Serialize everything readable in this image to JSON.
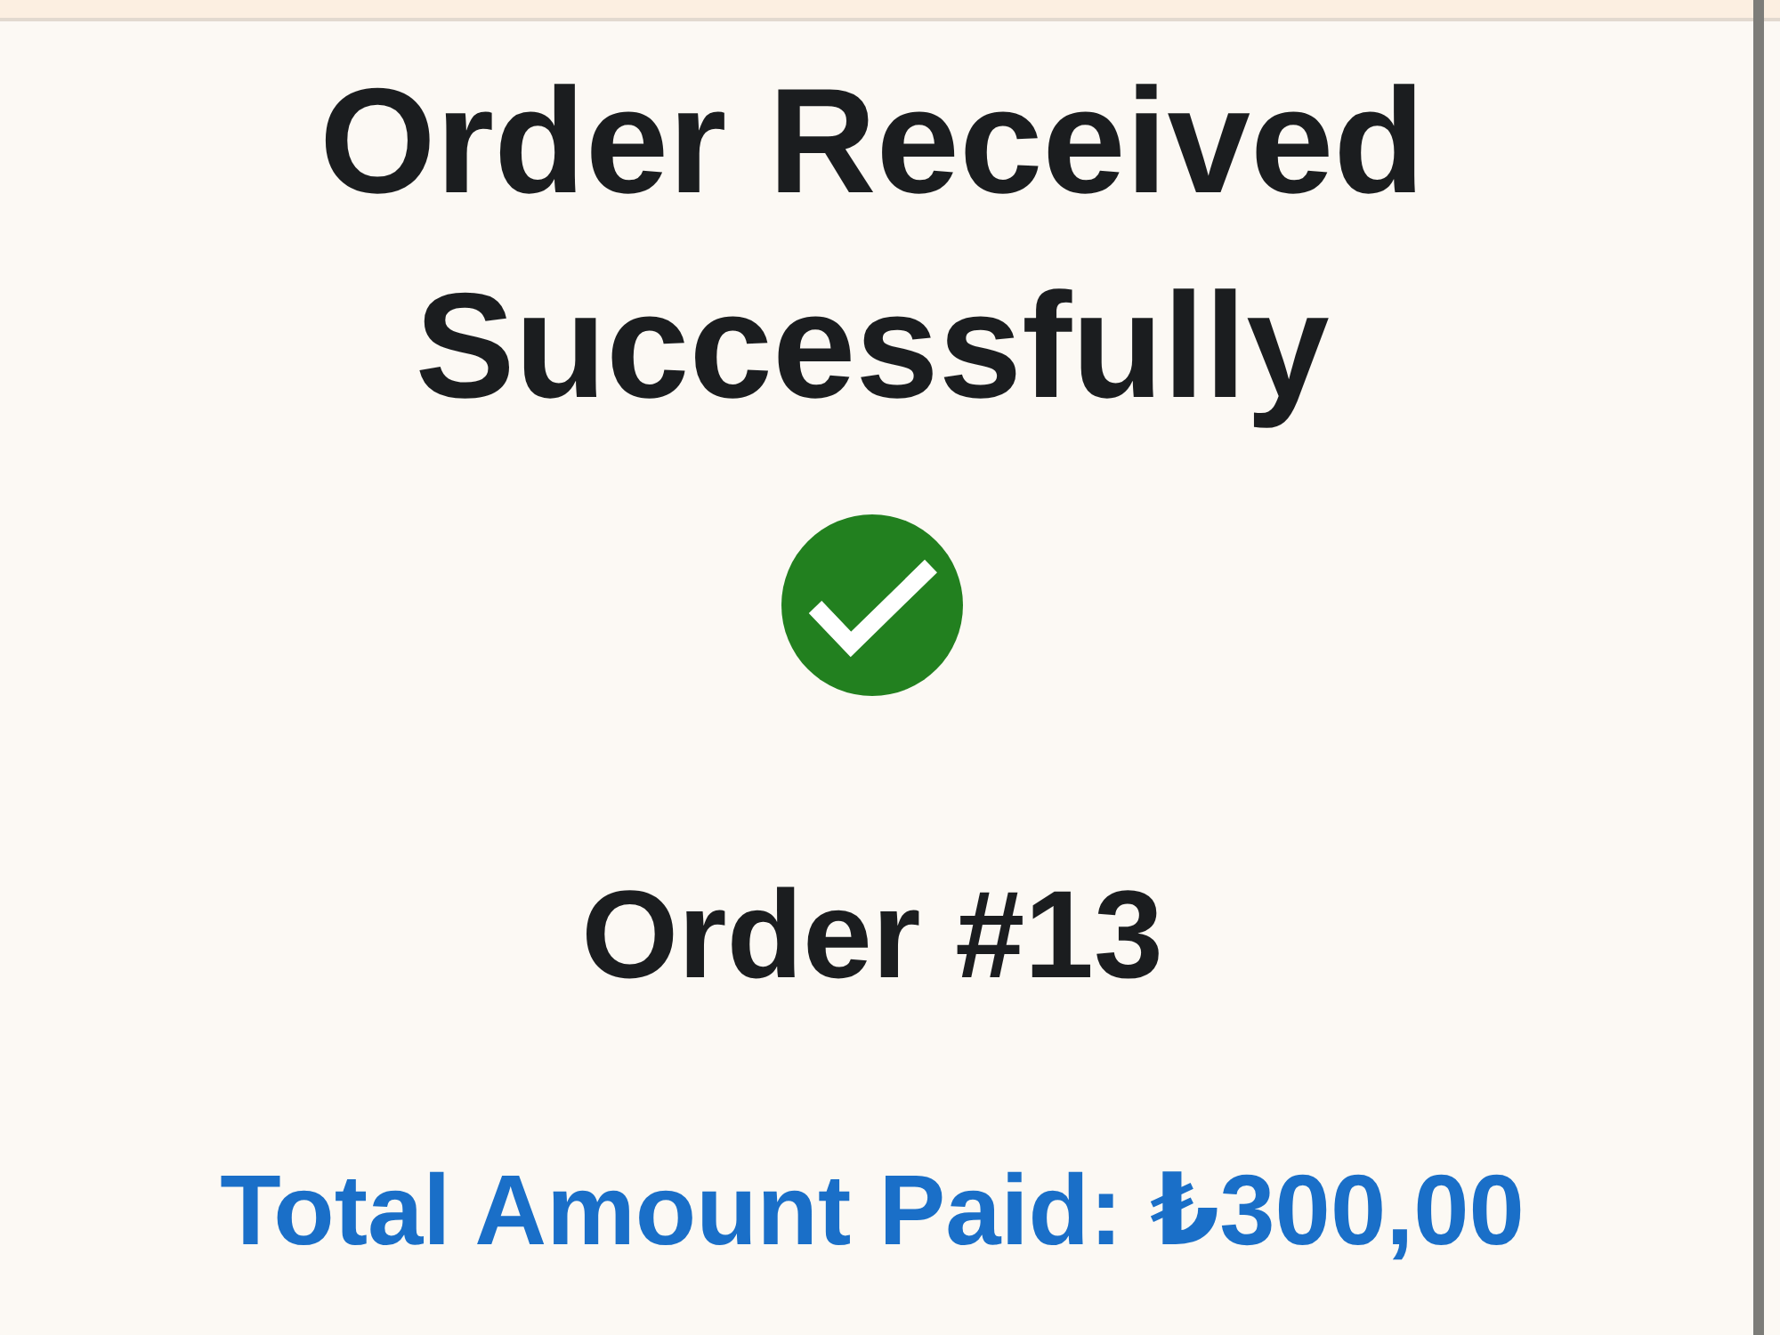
{
  "title": "Order Received Successfully",
  "order_label": "Order #13",
  "total": "Total Amount Paid: ₺300,00"
}
